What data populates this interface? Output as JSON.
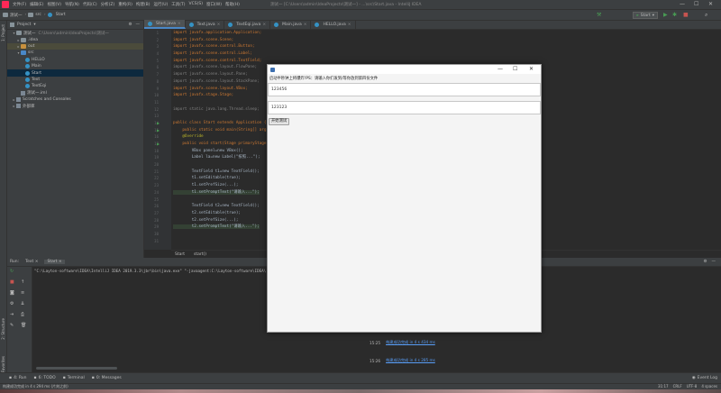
{
  "menubar": {
    "items": [
      "文件(F)",
      "编辑(E)",
      "视图(V)",
      "导航(N)",
      "代码(C)",
      "分析(Z)",
      "重构(R)",
      "构建(B)",
      "运行(U)",
      "工具(T)",
      "VCS(S)",
      "窗口(W)",
      "帮助(H)"
    ],
    "title": "测试一 [C:\\Users\\admin\\IdeaProjects\\测试一] - ...\\src\\Start.java - IntelliJ IDEA",
    "min": "—",
    "max": "☐",
    "close": "✕"
  },
  "navbar": {
    "crumbs": [
      "测试一",
      "src",
      "Start"
    ],
    "run_config": "Start",
    "icons": [
      "hammer-icon",
      "run-icon",
      "debug-icon",
      "stop-icon",
      "search-icon"
    ]
  },
  "left_strip": {
    "project": "1: Project",
    "structure": "2: Structure",
    "favorites": "2: Favorites"
  },
  "project": {
    "header": "Project",
    "tree": [
      {
        "label": "测试一",
        "extra": "C:\\Users\\admin\\IdeaProjects\\测试一",
        "indent": 1,
        "icon": "dir",
        "arrow": "▾"
      },
      {
        "label": ".idea",
        "indent": 2,
        "icon": "dir",
        "arrow": "▸"
      },
      {
        "label": "out",
        "indent": 2,
        "icon": "dir-orange",
        "arrow": "▸",
        "hl": true
      },
      {
        "label": "src",
        "indent": 2,
        "icon": "dir-blue",
        "arrow": "▾"
      },
      {
        "label": "HELLO",
        "indent": 3,
        "icon": "class"
      },
      {
        "label": "Main",
        "indent": 3,
        "icon": "class"
      },
      {
        "label": "Start",
        "indent": 3,
        "icon": "class",
        "sel": true
      },
      {
        "label": "Text",
        "indent": 3,
        "icon": "class"
      },
      {
        "label": "TextEqi",
        "indent": 3,
        "icon": "class"
      },
      {
        "label": "测试一.iml",
        "indent": 2,
        "icon": "file"
      },
      {
        "label": "Scratches and Consoles",
        "indent": 1,
        "icon": "lib",
        "arrow": "▸"
      },
      {
        "label": "外部库",
        "indent": 1,
        "icon": "lib",
        "arrow": "▸"
      }
    ]
  },
  "editor": {
    "tabs": [
      "Start.java",
      "Text.java",
      "TextEqi.java",
      "Main.java",
      "HELLO.java"
    ],
    "lines": [
      {
        "n": "1",
        "code": "import javafx.application.Application;",
        "cls": "imp"
      },
      {
        "n": "2",
        "code": "import javafx.scene.Scene;",
        "cls": "imp"
      },
      {
        "n": "3",
        "code": "import javafx.scene.control.Button;",
        "cls": "imp"
      },
      {
        "n": "4",
        "code": "import javafx.scene.control.Label;",
        "cls": "imp"
      },
      {
        "n": "5",
        "code": "import javafx.scene.control.TextField;",
        "cls": "imp"
      },
      {
        "n": "6",
        "code": "import javafx.scene.layout.FlowPane;",
        "cls": "dimimp"
      },
      {
        "n": "7",
        "code": "import javafx.scene.layout.Pane;",
        "cls": "dimimp"
      },
      {
        "n": "8",
        "code": "import javafx.scene.layout.StackPane;",
        "cls": "dimimp"
      },
      {
        "n": "9",
        "code": "import javafx.scene.layout.VBox;",
        "cls": "imp"
      },
      {
        "n": "10",
        "code": "import javafx.stage.Stage;",
        "cls": "imp"
      },
      {
        "n": "11",
        "code": "",
        "cls": ""
      },
      {
        "n": "12",
        "code": "import static java.lang.Thread.sleep;",
        "cls": "dimimp"
      },
      {
        "n": "13",
        "code": "",
        "cls": ""
      },
      {
        "n": "14",
        "code": "public class Start extends Application {",
        "cls": "decl"
      },
      {
        "n": "15",
        "code": "    public static void main(String[] args) {",
        "cls": "decl"
      },
      {
        "n": "16",
        "code": "    @Override",
        "cls": "anno"
      },
      {
        "n": "17",
        "code": "    public void start(Stage primaryStage) {",
        "cls": "decl"
      },
      {
        "n": "18",
        "code": "        VBox panel=new VBox();",
        "cls": "body"
      },
      {
        "n": "19",
        "code": "        Label la=new Label(\"按照...\");",
        "cls": "body"
      },
      {
        "n": "20",
        "code": "",
        "cls": ""
      },
      {
        "n": "21",
        "code": "        TextField t1=new TextField();",
        "cls": "body"
      },
      {
        "n": "22",
        "code": "        t1.setEditable(true);",
        "cls": "body"
      },
      {
        "n": "23",
        "code": "        t1.setPrefSize(...);",
        "cls": "body"
      },
      {
        "n": "24",
        "code": "        t1.setPromptText(\"请输入...\");",
        "cls": "hl"
      },
      {
        "n": "25",
        "code": "",
        "cls": ""
      },
      {
        "n": "26",
        "code": "        TextField t2=new TextField();",
        "cls": "body"
      },
      {
        "n": "27",
        "code": "        t2.setEditable(true);",
        "cls": "body"
      },
      {
        "n": "28",
        "code": "        t2.setPrefSize(...);",
        "cls": "body"
      },
      {
        "n": "29",
        "code": "        t2.setPromptText(\"请输入...\");",
        "cls": "hl"
      },
      {
        "n": "30",
        "code": "",
        "cls": ""
      },
      {
        "n": "31",
        "code": "",
        "cls": ""
      }
    ],
    "breadcrumb": [
      "Start",
      "start()"
    ]
  },
  "run": {
    "label": "Run:",
    "tabs": [
      "Text",
      "Start"
    ],
    "console_line": "\"C:\\Layton-software\\IDEA\\IntelliJ IDEA 2019.3.3\\jbr\\bin\\java.exe\" \"-javaagent:C:\\Layton-software\\IDEA\\..."
  },
  "event_log": [
    {
      "time": "15:25",
      "link": "构建成功完成 in 4 s 434 ms"
    },
    {
      "time": "15:26",
      "link": "构建成功完成 in 4 s 285 ms"
    }
  ],
  "bottom_tabs": [
    "4: Run",
    "6: TODO",
    "Terminal",
    "0: Messages"
  ],
  "bottom_right": "Event Log",
  "status": {
    "left": "构建成功完成 in 4 s 294 ms (片刻之前)",
    "right": [
      "31:17",
      "CRLF",
      "UTF-8",
      "4 spaces"
    ]
  },
  "app": {
    "label": "启动半秒钟上将爆炸!PS：请输入你们发到/等你放到第四份文件",
    "field1": "123456",
    "field2": "123123",
    "button": "开始测试",
    "min": "—",
    "max": "☐",
    "close": "✕"
  },
  "colors": {
    "ide_bg": "#2b2b2b",
    "panel_bg": "#3c3f41",
    "accent": "#4a88c7",
    "link": "#589df6"
  }
}
